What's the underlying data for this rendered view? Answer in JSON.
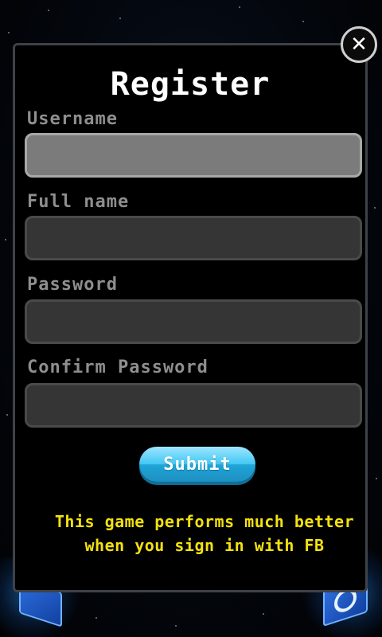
{
  "dialog": {
    "title": "Register",
    "close_icon": "close-icon",
    "fields": [
      {
        "label": "Username",
        "value": "",
        "placeholder": ""
      },
      {
        "label": "Full name",
        "value": "",
        "placeholder": ""
      },
      {
        "label": "Password",
        "value": "",
        "placeholder": ""
      },
      {
        "label": "Confirm Password",
        "value": "",
        "placeholder": ""
      }
    ],
    "submit_label": "Submit",
    "fb_message": "This game performs much better when you sign in with FB"
  },
  "colors": {
    "accent_button": "#41c7f4",
    "message_text": "#f3e10f",
    "label_text": "#8e8e8e",
    "field_bg": "#353535",
    "field_active_bg": "#7b7b7b"
  }
}
